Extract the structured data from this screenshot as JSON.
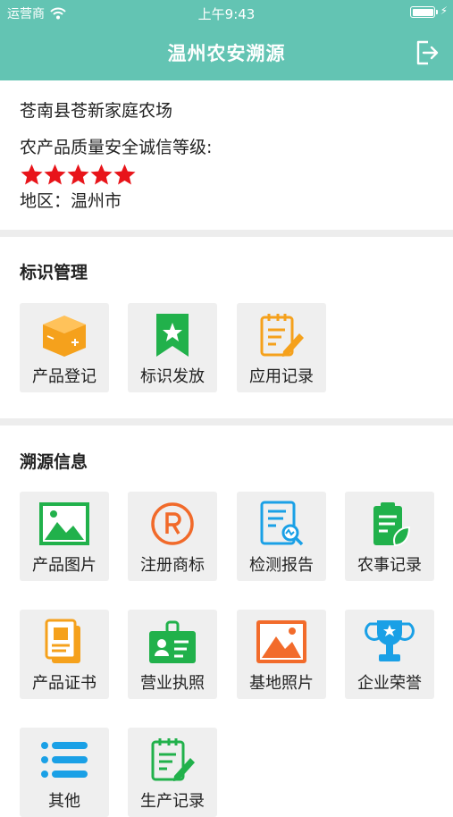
{
  "status_bar": {
    "carrier": "运营商",
    "time": "上午9:43"
  },
  "nav": {
    "title": "温州农安溯源"
  },
  "farm": {
    "name": "苍南县苍新家庭农场",
    "grade_label": "农产品质量安全诚信等级:",
    "stars": 5,
    "region": "地区：温州市",
    "star_color": "#e8141a"
  },
  "sections": {
    "mark_mgmt": {
      "title": "标识管理",
      "items": [
        {
          "label": "产品登记",
          "icon": "box-icon"
        },
        {
          "label": "标识发放",
          "icon": "bookmark-star-icon"
        },
        {
          "label": "应用记录",
          "icon": "clipboard-pen-icon"
        }
      ]
    },
    "trace_info": {
      "title": "溯源信息",
      "items": [
        {
          "label": "产品图片",
          "icon": "picture-icon"
        },
        {
          "label": "注册商标",
          "icon": "registered-icon"
        },
        {
          "label": "检测报告",
          "icon": "report-search-icon"
        },
        {
          "label": "农事记录",
          "icon": "clipboard-leaf-icon"
        },
        {
          "label": "产品证书",
          "icon": "certificate-icon"
        },
        {
          "label": "营业执照",
          "icon": "license-card-icon"
        },
        {
          "label": "基地照片",
          "icon": "photo-icon"
        },
        {
          "label": "企业荣誉",
          "icon": "trophy-icon"
        },
        {
          "label": "其他",
          "icon": "list-icon"
        },
        {
          "label": "生产记录",
          "icon": "clipboard-pen-green-icon"
        }
      ]
    }
  },
  "colors": {
    "header": "#63c4b3",
    "orange": "#f5a11c",
    "green": "#21b14b",
    "blue": "#1aa0e6"
  }
}
